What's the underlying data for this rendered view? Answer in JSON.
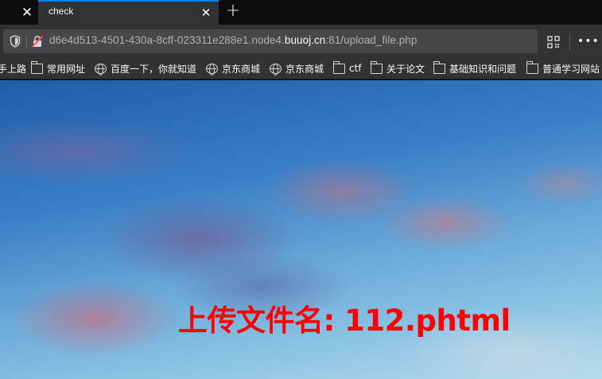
{
  "tabbar": {
    "prev_tab_close": "✕",
    "active_tab": {
      "title": "check",
      "close": "✕"
    },
    "new_tab": "+"
  },
  "navbar": {
    "url_prefix": "d6e4d513-4501-430a-8cff-023311e288e1.node4.",
    "url_host": "buuoj.cn",
    "url_suffix": ":81/upload_file.php",
    "more": "•••",
    "icons": [
      "shield-icon",
      "insecure-lock-icon",
      "qr-code-icon",
      "more-menu-icon"
    ]
  },
  "bookmarks": {
    "items": [
      {
        "label": "手上路",
        "icon": "none"
      },
      {
        "label": "常用网址",
        "icon": "folder-icon"
      },
      {
        "label": "百度一下，你就知道",
        "icon": "globe-icon"
      },
      {
        "label": "京东商城",
        "icon": "globe-icon"
      },
      {
        "label": "京东商城",
        "icon": "globe-icon"
      },
      {
        "label": "ctf",
        "icon": "folder-icon"
      },
      {
        "label": "关于论文",
        "icon": "folder-icon"
      },
      {
        "label": "基础知识和问题",
        "icon": "folder-icon"
      },
      {
        "label": "普通学习网站",
        "icon": "folder-icon"
      }
    ]
  },
  "page": {
    "message": "上传文件名: 112.phtml",
    "message_color": "#ff0000"
  }
}
